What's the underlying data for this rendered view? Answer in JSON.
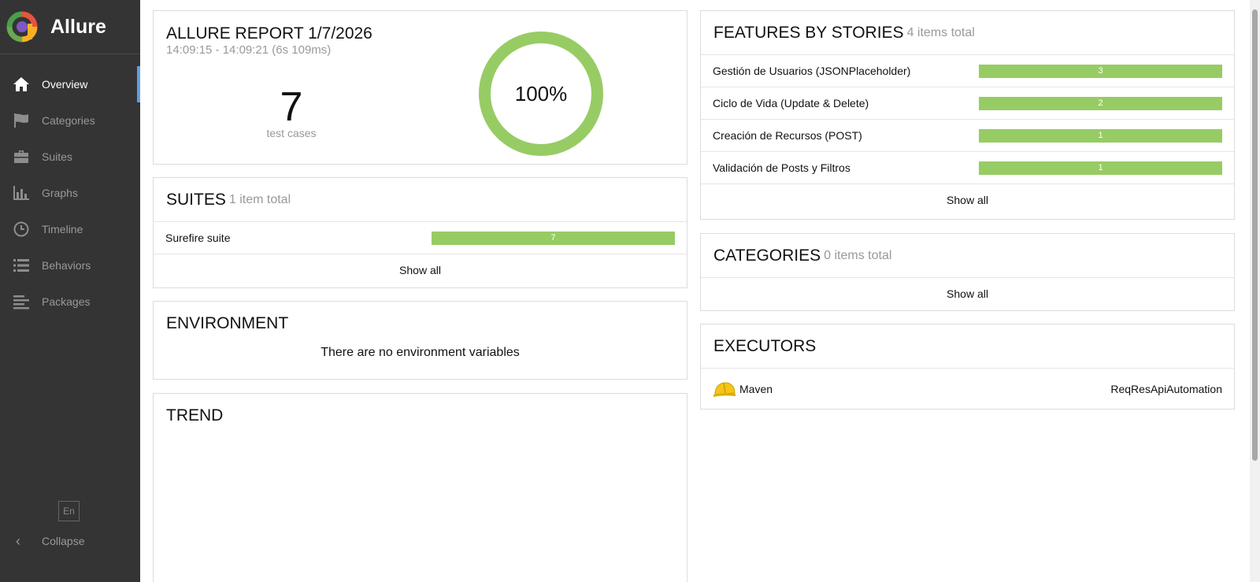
{
  "app": {
    "name": "Allure"
  },
  "sidebar": {
    "items": [
      {
        "label": "Overview",
        "icon": "home-icon",
        "active": true
      },
      {
        "label": "Categories",
        "icon": "flag-icon",
        "active": false
      },
      {
        "label": "Suites",
        "icon": "briefcase-icon",
        "active": false
      },
      {
        "label": "Graphs",
        "icon": "bar-chart-icon",
        "active": false
      },
      {
        "label": "Timeline",
        "icon": "clock-icon",
        "active": false
      },
      {
        "label": "Behaviors",
        "icon": "list-icon",
        "active": false
      },
      {
        "label": "Packages",
        "icon": "align-left-icon",
        "active": false
      }
    ],
    "language": "En",
    "collapse_label": "Collapse"
  },
  "summary": {
    "title": "ALLURE REPORT 1/7/2026",
    "time_range": "14:09:15 - 14:09:21 (6s 109ms)",
    "count": "7",
    "count_label": "test cases",
    "percent_text": "100%",
    "passed_fraction": 1.0
  },
  "suites": {
    "title": "SUITES",
    "subtitle": "1 item total",
    "rows": [
      {
        "name": "Surefire suite",
        "value": "7"
      }
    ],
    "show_all": "Show all"
  },
  "environment": {
    "title": "ENVIRONMENT",
    "message": "There are no environment variables"
  },
  "trend": {
    "title": "TREND"
  },
  "features": {
    "title": "FEATURES BY STORIES",
    "subtitle": "4 items total",
    "rows": [
      {
        "name": "Gestión de Usuarios (JSONPlaceholder)",
        "value": "3"
      },
      {
        "name": "Ciclo de Vida (Update & Delete)",
        "value": "2"
      },
      {
        "name": "Creación de Recursos (POST)",
        "value": "1"
      },
      {
        "name": "Validación de Posts y Filtros",
        "value": "1"
      }
    ],
    "show_all": "Show all"
  },
  "categories": {
    "title": "CATEGORIES",
    "subtitle": "0 items total",
    "show_all": "Show all"
  },
  "executors": {
    "title": "EXECUTORS",
    "name": "Maven",
    "build": "ReqResApiAutomation",
    "icon": "hard-hat-icon"
  },
  "colors": {
    "sidebar_bg": "#343434",
    "accent": "#5d9fe6",
    "passed": "#97cc64"
  }
}
